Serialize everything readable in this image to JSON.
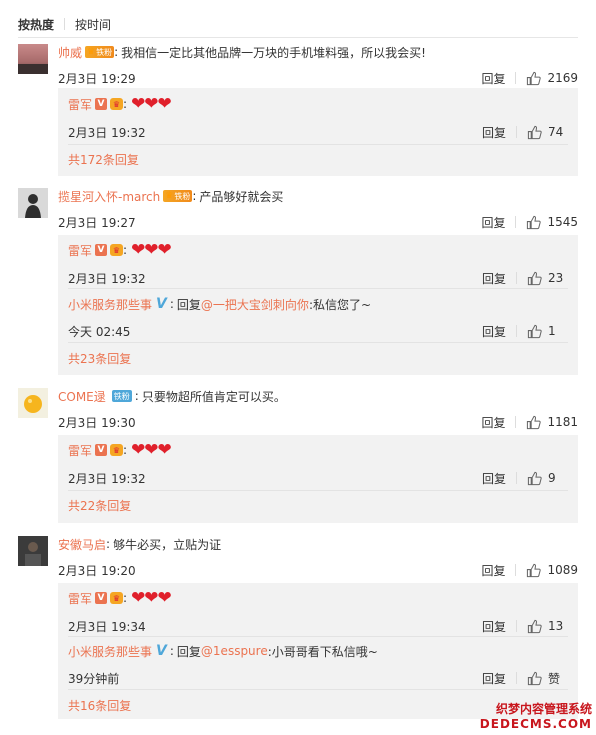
{
  "sort": {
    "hot": "按热度",
    "time": "按时间"
  },
  "reply_label": "回复",
  "colors": {
    "accent": "#eb7350",
    "heart": "#e0202b",
    "subbg": "#f2f2f2"
  },
  "comments": [
    {
      "user": "帅威",
      "badge": "铁粉",
      "text": "我相信一定比其他品牌一万块的手机堆料强，所以我会买!",
      "time": "2月3日 19:29",
      "likes": "2169",
      "replies": [
        {
          "user": "雷军",
          "time": "2月3日 19:32",
          "likes": "74"
        }
      ],
      "more": "共172条回复"
    },
    {
      "user": "揽星河入怀-march",
      "badge": "铁粉",
      "text": "产品够好就会买",
      "time": "2月3日 19:27",
      "likes": "1545",
      "replies": [
        {
          "user": "雷军",
          "time": "2月3日 19:32",
          "likes": "23"
        },
        {
          "user": "小米服务那些事",
          "reply_prefix": "回复",
          "mention": "@一把大宝剑刺向你",
          "text": ":私信您了~",
          "time": "今天 02:45",
          "likes": "1"
        }
      ],
      "more": "共23条回复"
    },
    {
      "user": "COME逯",
      "badge": "铁粉",
      "text": "只要物超所值肯定可以买。",
      "time": "2月3日 19:30",
      "likes": "1181",
      "replies": [
        {
          "user": "雷军",
          "time": "2月3日 19:32",
          "likes": "9"
        }
      ],
      "more": "共22条回复"
    },
    {
      "user": "安徽马启",
      "text": "够牛必买，立贴为证",
      "time": "2月3日 19:20",
      "likes": "1089",
      "replies": [
        {
          "user": "雷军",
          "time": "2月3日 19:34",
          "likes": "13"
        },
        {
          "user": "小米服务那些事",
          "reply_prefix": "回复",
          "mention": "@1esspure",
          "text": ":小哥哥看下私信哦~",
          "time": "39分钟前",
          "likes": "赞"
        }
      ],
      "more": "共16条回复"
    }
  ],
  "hearts": "❤❤❤",
  "icons": {
    "like": "thumbs-up-icon",
    "verified_personal": "v-icon",
    "verified_org": "v-blue-icon",
    "vip": "vip-crown-icon"
  },
  "watermark": {
    "line1": "织梦内容管理系统",
    "line2": "DEDECMS.COM"
  }
}
